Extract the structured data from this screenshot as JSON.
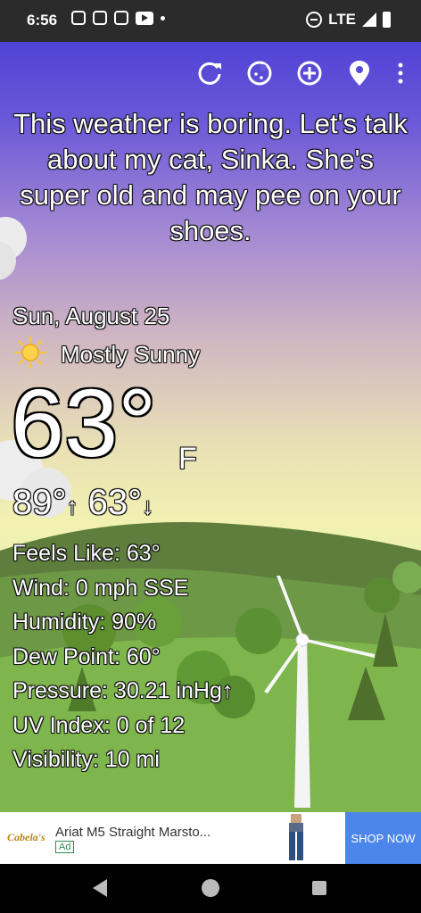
{
  "status": {
    "time": "6:56",
    "network": "LTE"
  },
  "toolbar": {
    "refresh": "refresh-icon",
    "theme": "cookie-icon",
    "add": "add-location-icon",
    "location": "location-pin-icon",
    "menu": "more-vert-icon"
  },
  "headline": "This weather is boring. Let's talk about my cat, Sinka. She's super old and may pee on your shoes.",
  "date": "Sun, August 25",
  "condition": {
    "icon": "sun-icon",
    "text": "Mostly Sunny"
  },
  "temperature": {
    "value": "63°",
    "unit": "F"
  },
  "hilo": {
    "high": "89°",
    "high_arrow": "↑",
    "low": "63°",
    "low_arrow": "↓"
  },
  "details": [
    "Feels Like:  63°",
    "Wind:  0 mph SSE",
    "Humidity:  90%",
    "Dew Point:  60°",
    "Pressure:  30.21 inHg↑",
    "UV Index:  0 of 12",
    "Visibility:  10 mi"
  ],
  "ad": {
    "brand": "Cabela's",
    "title": "Ariat M5 Straight Marsto...",
    "tag": "Ad",
    "cta": "SHOP NOW"
  },
  "colors": {
    "accent": "#4c86ea",
    "sky_top": "#4f43d6",
    "sky_bottom": "#f2f2b0",
    "grass": "#7eb64d"
  }
}
